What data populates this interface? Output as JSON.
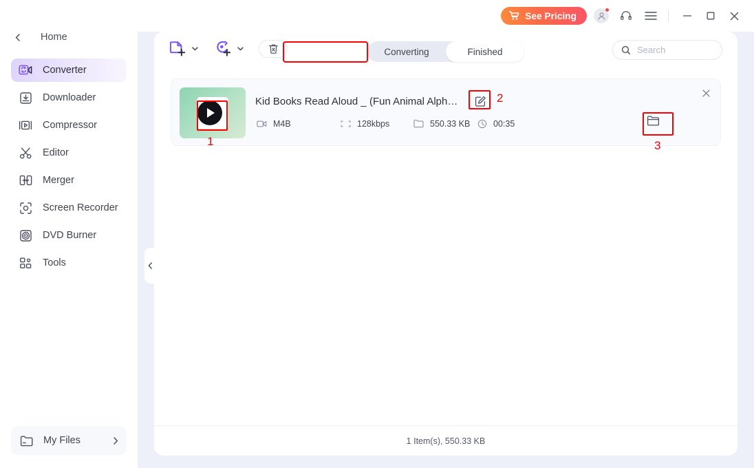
{
  "app": {
    "background": "#edf0f9",
    "accent": "#7b54f4",
    "annotation_color": "#fe0000"
  },
  "titlebar": {
    "pricing_label": "See Pricing",
    "pricing_gradient": [
      "#fa8a3c",
      "#fb5566"
    ],
    "icons": {
      "cart": "cart-icon",
      "account": "account-icon",
      "support": "headset-icon",
      "menu": "hamburger-menu-icon",
      "minimize": "minimize-icon",
      "maximize": "maximize-icon",
      "close": "close-icon"
    }
  },
  "sidebar": {
    "home_label": "Home",
    "back_chevron": "chevron-left-icon",
    "items": [
      {
        "label": "Converter",
        "icon": "converter-icon",
        "active": true
      },
      {
        "label": "Downloader",
        "icon": "downloader-icon",
        "active": false
      },
      {
        "label": "Compressor",
        "icon": "compressor-icon",
        "active": false
      },
      {
        "label": "Editor",
        "icon": "scissors-icon",
        "active": false
      },
      {
        "label": "Merger",
        "icon": "merger-icon",
        "active": false
      },
      {
        "label": "Screen Recorder",
        "icon": "screen-recorder-icon",
        "active": false
      },
      {
        "label": "DVD Burner",
        "icon": "disc-icon",
        "active": false
      },
      {
        "label": "Tools",
        "icon": "tools-grid-icon",
        "active": false
      }
    ],
    "my_files_label": "My Files",
    "my_files_chevron": "chevron-right-icon",
    "active_highlight": "#ded5fb"
  },
  "toolbar": {
    "add_files_icon": "add-file-icon",
    "add_files_caret": "chevron-down-icon",
    "add_disc_icon": "add-disc-icon",
    "add_disc_caret": "chevron-down-icon",
    "clear_icon": "trash-icon",
    "tabs": [
      {
        "label": "Converting",
        "active": false
      },
      {
        "label": "Finished",
        "active": true
      }
    ],
    "search": {
      "placeholder": "Search",
      "value": "",
      "icon": "search-icon"
    }
  },
  "file_list": {
    "items": [
      {
        "title": "Kid Books Read Aloud _ (Fun Animal Alph…",
        "thumbnail_icon": "video-play-thumbnail",
        "edit_icon": "edit-pencil-icon",
        "open_folder_icon": "folder-open-icon",
        "remove_icon": "close-icon",
        "meta": [
          {
            "icon": "video-format-icon",
            "value": "M4B"
          },
          {
            "icon": "resolution-icon",
            "value": "128kbps"
          },
          {
            "icon": "folder-icon",
            "value": "550.33 KB"
          },
          {
            "icon": "clock-icon",
            "value": "00:35"
          }
        ]
      }
    ]
  },
  "footer": {
    "summary": "1 Item(s), 550.33 KB"
  },
  "annotations": [
    {
      "number": "1",
      "target": "play-button-thumbnail"
    },
    {
      "number": "2",
      "target": "edit-file-name-button"
    },
    {
      "number": "3",
      "target": "open-output-folder-button"
    }
  ]
}
